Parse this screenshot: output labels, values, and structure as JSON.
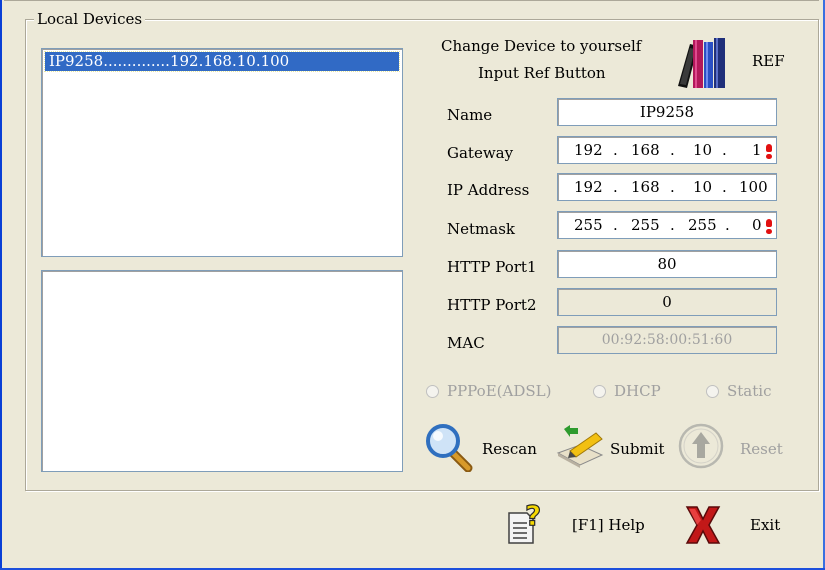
{
  "group": {
    "legend": "Local Devices"
  },
  "devices": [
    {
      "label": "IP9258..............192.168.10.100"
    }
  ],
  "ref_panel": {
    "line1": "Change Device to yourself",
    "line2": "Input Ref Button",
    "ref_label": "REF"
  },
  "form": {
    "name_label": "Name",
    "name_value": "IP9258",
    "gateway_label": "Gateway",
    "gateway": [
      "192",
      "168",
      "10",
      "1"
    ],
    "ip_label": "IP Address",
    "ip": [
      "192",
      "168",
      "10",
      "100"
    ],
    "netmask_label": "Netmask",
    "netmask": [
      "255",
      "255",
      "255",
      "0"
    ],
    "http1_label": "HTTP Port1",
    "http1_value": "80",
    "http2_label": "HTTP Port2",
    "http2_value": "0",
    "mac_label": "MAC",
    "mac_value": "00:92:58:00:51:60",
    "dot": "."
  },
  "modes": {
    "pppoe": "PPPoE(ADSL)",
    "dhcp": "DHCP",
    "static": "Static"
  },
  "actions": {
    "rescan": "Rescan",
    "submit": "Submit",
    "reset": "Reset"
  },
  "footer": {
    "help": "[F1] Help",
    "exit": "Exit"
  },
  "colors": {
    "selection": "#316ac5",
    "required_marker": "#e21010",
    "window_border": "#0a3fd6"
  },
  "icons": {
    "ref": "books-icon",
    "rescan": "magnifier-icon",
    "submit": "submit-pen-icon",
    "reset": "up-arrow-circle-icon",
    "help": "help-document-icon",
    "exit": "red-x-icon",
    "required": "exclamation-icon"
  }
}
